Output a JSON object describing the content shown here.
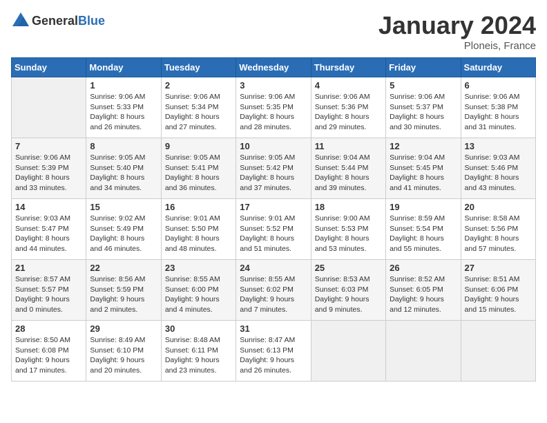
{
  "logo": {
    "general": "General",
    "blue": "Blue"
  },
  "title": "January 2024",
  "location": "Ploneis, France",
  "days_of_week": [
    "Sunday",
    "Monday",
    "Tuesday",
    "Wednesday",
    "Thursday",
    "Friday",
    "Saturday"
  ],
  "weeks": [
    [
      {
        "day": "",
        "sunrise": "",
        "sunset": "",
        "daylight": ""
      },
      {
        "day": "1",
        "sunrise": "Sunrise: 9:06 AM",
        "sunset": "Sunset: 5:33 PM",
        "daylight": "Daylight: 8 hours and 26 minutes."
      },
      {
        "day": "2",
        "sunrise": "Sunrise: 9:06 AM",
        "sunset": "Sunset: 5:34 PM",
        "daylight": "Daylight: 8 hours and 27 minutes."
      },
      {
        "day": "3",
        "sunrise": "Sunrise: 9:06 AM",
        "sunset": "Sunset: 5:35 PM",
        "daylight": "Daylight: 8 hours and 28 minutes."
      },
      {
        "day": "4",
        "sunrise": "Sunrise: 9:06 AM",
        "sunset": "Sunset: 5:36 PM",
        "daylight": "Daylight: 8 hours and 29 minutes."
      },
      {
        "day": "5",
        "sunrise": "Sunrise: 9:06 AM",
        "sunset": "Sunset: 5:37 PM",
        "daylight": "Daylight: 8 hours and 30 minutes."
      },
      {
        "day": "6",
        "sunrise": "Sunrise: 9:06 AM",
        "sunset": "Sunset: 5:38 PM",
        "daylight": "Daylight: 8 hours and 31 minutes."
      }
    ],
    [
      {
        "day": "7",
        "sunrise": "Sunrise: 9:06 AM",
        "sunset": "Sunset: 5:39 PM",
        "daylight": "Daylight: 8 hours and 33 minutes."
      },
      {
        "day": "8",
        "sunrise": "Sunrise: 9:05 AM",
        "sunset": "Sunset: 5:40 PM",
        "daylight": "Daylight: 8 hours and 34 minutes."
      },
      {
        "day": "9",
        "sunrise": "Sunrise: 9:05 AM",
        "sunset": "Sunset: 5:41 PM",
        "daylight": "Daylight: 8 hours and 36 minutes."
      },
      {
        "day": "10",
        "sunrise": "Sunrise: 9:05 AM",
        "sunset": "Sunset: 5:42 PM",
        "daylight": "Daylight: 8 hours and 37 minutes."
      },
      {
        "day": "11",
        "sunrise": "Sunrise: 9:04 AM",
        "sunset": "Sunset: 5:44 PM",
        "daylight": "Daylight: 8 hours and 39 minutes."
      },
      {
        "day": "12",
        "sunrise": "Sunrise: 9:04 AM",
        "sunset": "Sunset: 5:45 PM",
        "daylight": "Daylight: 8 hours and 41 minutes."
      },
      {
        "day": "13",
        "sunrise": "Sunrise: 9:03 AM",
        "sunset": "Sunset: 5:46 PM",
        "daylight": "Daylight: 8 hours and 43 minutes."
      }
    ],
    [
      {
        "day": "14",
        "sunrise": "Sunrise: 9:03 AM",
        "sunset": "Sunset: 5:47 PM",
        "daylight": "Daylight: 8 hours and 44 minutes."
      },
      {
        "day": "15",
        "sunrise": "Sunrise: 9:02 AM",
        "sunset": "Sunset: 5:49 PM",
        "daylight": "Daylight: 8 hours and 46 minutes."
      },
      {
        "day": "16",
        "sunrise": "Sunrise: 9:01 AM",
        "sunset": "Sunset: 5:50 PM",
        "daylight": "Daylight: 8 hours and 48 minutes."
      },
      {
        "day": "17",
        "sunrise": "Sunrise: 9:01 AM",
        "sunset": "Sunset: 5:52 PM",
        "daylight": "Daylight: 8 hours and 51 minutes."
      },
      {
        "day": "18",
        "sunrise": "Sunrise: 9:00 AM",
        "sunset": "Sunset: 5:53 PM",
        "daylight": "Daylight: 8 hours and 53 minutes."
      },
      {
        "day": "19",
        "sunrise": "Sunrise: 8:59 AM",
        "sunset": "Sunset: 5:54 PM",
        "daylight": "Daylight: 8 hours and 55 minutes."
      },
      {
        "day": "20",
        "sunrise": "Sunrise: 8:58 AM",
        "sunset": "Sunset: 5:56 PM",
        "daylight": "Daylight: 8 hours and 57 minutes."
      }
    ],
    [
      {
        "day": "21",
        "sunrise": "Sunrise: 8:57 AM",
        "sunset": "Sunset: 5:57 PM",
        "daylight": "Daylight: 9 hours and 0 minutes."
      },
      {
        "day": "22",
        "sunrise": "Sunrise: 8:56 AM",
        "sunset": "Sunset: 5:59 PM",
        "daylight": "Daylight: 9 hours and 2 minutes."
      },
      {
        "day": "23",
        "sunrise": "Sunrise: 8:55 AM",
        "sunset": "Sunset: 6:00 PM",
        "daylight": "Daylight: 9 hours and 4 minutes."
      },
      {
        "day": "24",
        "sunrise": "Sunrise: 8:55 AM",
        "sunset": "Sunset: 6:02 PM",
        "daylight": "Daylight: 9 hours and 7 minutes."
      },
      {
        "day": "25",
        "sunrise": "Sunrise: 8:53 AM",
        "sunset": "Sunset: 6:03 PM",
        "daylight": "Daylight: 9 hours and 9 minutes."
      },
      {
        "day": "26",
        "sunrise": "Sunrise: 8:52 AM",
        "sunset": "Sunset: 6:05 PM",
        "daylight": "Daylight: 9 hours and 12 minutes."
      },
      {
        "day": "27",
        "sunrise": "Sunrise: 8:51 AM",
        "sunset": "Sunset: 6:06 PM",
        "daylight": "Daylight: 9 hours and 15 minutes."
      }
    ],
    [
      {
        "day": "28",
        "sunrise": "Sunrise: 8:50 AM",
        "sunset": "Sunset: 6:08 PM",
        "daylight": "Daylight: 9 hours and 17 minutes."
      },
      {
        "day": "29",
        "sunrise": "Sunrise: 8:49 AM",
        "sunset": "Sunset: 6:10 PM",
        "daylight": "Daylight: 9 hours and 20 minutes."
      },
      {
        "day": "30",
        "sunrise": "Sunrise: 8:48 AM",
        "sunset": "Sunset: 6:11 PM",
        "daylight": "Daylight: 9 hours and 23 minutes."
      },
      {
        "day": "31",
        "sunrise": "Sunrise: 8:47 AM",
        "sunset": "Sunset: 6:13 PM",
        "daylight": "Daylight: 9 hours and 26 minutes."
      },
      {
        "day": "",
        "sunrise": "",
        "sunset": "",
        "daylight": ""
      },
      {
        "day": "",
        "sunrise": "",
        "sunset": "",
        "daylight": ""
      },
      {
        "day": "",
        "sunrise": "",
        "sunset": "",
        "daylight": ""
      }
    ]
  ]
}
